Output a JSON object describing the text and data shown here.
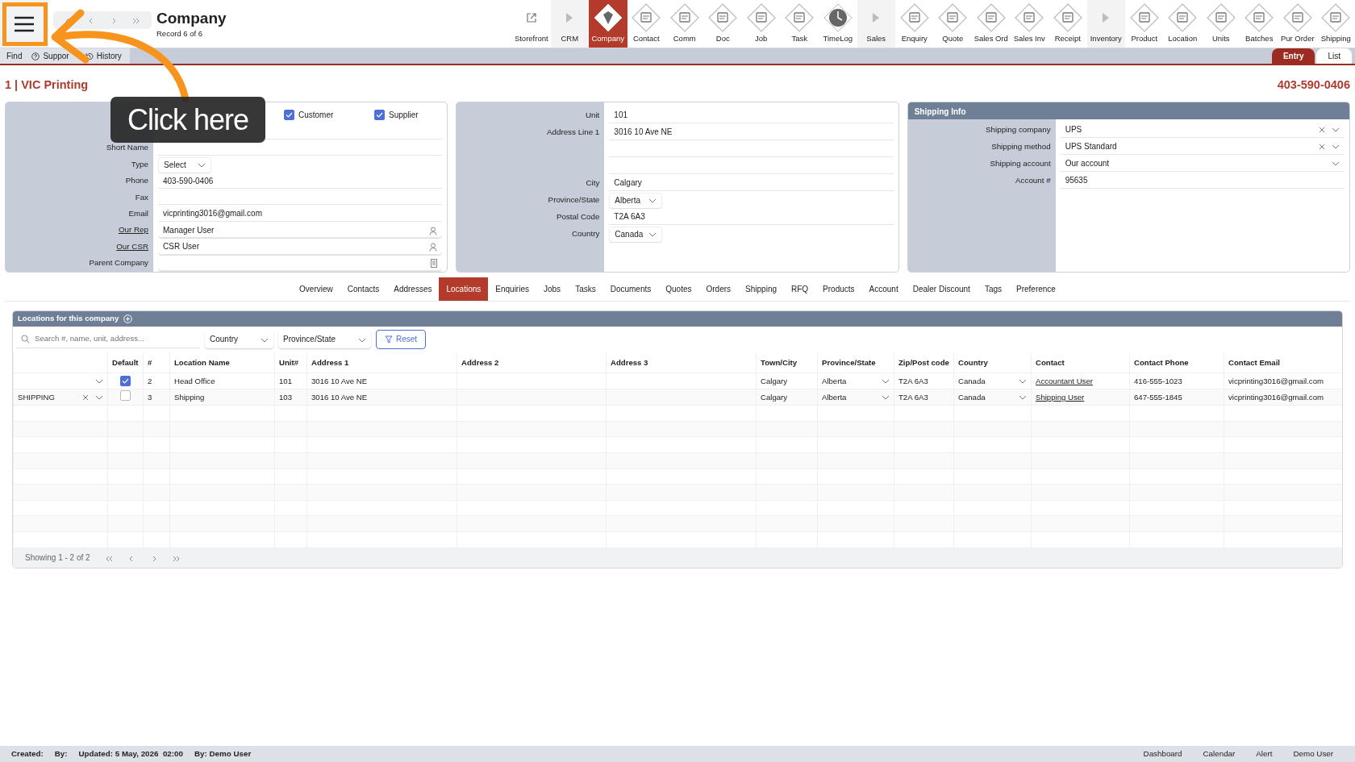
{
  "header": {
    "title": "Company",
    "subtitle": "Record 6 of 6"
  },
  "toolbar": [
    {
      "label": "Storefront",
      "kind": "link",
      "selected": false
    },
    {
      "label": "CRM",
      "kind": "section",
      "selected": false
    },
    {
      "label": "Company",
      "kind": "module",
      "selected": true
    },
    {
      "label": "Contact",
      "kind": "module",
      "selected": false
    },
    {
      "label": "Comm",
      "kind": "module",
      "selected": false
    },
    {
      "label": "Doc",
      "kind": "module",
      "selected": false
    },
    {
      "label": "Job",
      "kind": "module",
      "selected": false
    },
    {
      "label": "Task",
      "kind": "module",
      "selected": false
    },
    {
      "label": "TimeLog",
      "kind": "clock",
      "selected": false
    },
    {
      "label": "Sales",
      "kind": "section",
      "selected": false
    },
    {
      "label": "Enquiry",
      "kind": "module",
      "selected": false
    },
    {
      "label": "Quote",
      "kind": "module",
      "selected": false
    },
    {
      "label": "Sales Ord",
      "kind": "module",
      "selected": false
    },
    {
      "label": "Sales Inv",
      "kind": "module",
      "selected": false
    },
    {
      "label": "Receipt",
      "kind": "module",
      "selected": false
    },
    {
      "label": "Inventory",
      "kind": "section",
      "selected": false
    },
    {
      "label": "Product",
      "kind": "module",
      "selected": false
    },
    {
      "label": "Location",
      "kind": "module",
      "selected": false
    },
    {
      "label": "Units",
      "kind": "module",
      "selected": false
    },
    {
      "label": "Batches",
      "kind": "module",
      "selected": false
    },
    {
      "label": "Pur Order",
      "kind": "module",
      "selected": false
    },
    {
      "label": "Shipping",
      "kind": "module",
      "selected": false
    }
  ],
  "subbar": {
    "items": [
      {
        "label": "Find",
        "kind": "plain"
      },
      {
        "label": "Suppor",
        "kind": "help"
      },
      {
        "label": "History",
        "kind": "history"
      }
    ],
    "views": [
      {
        "label": "Entry",
        "selected": true
      },
      {
        "label": "List",
        "selected": false
      }
    ]
  },
  "record": {
    "title": "1 | VIC Printing",
    "phone": "403-590-0406"
  },
  "company_form": {
    "checkboxes": [
      {
        "label": "Customer",
        "checked": true
      },
      {
        "label": "Supplier",
        "checked": true
      }
    ],
    "fields": [
      {
        "kind": "checks"
      },
      {
        "kind": "text"
      },
      {
        "label": "Short Name",
        "kind": "text"
      },
      {
        "label": "Type",
        "kind": "select",
        "value": "Select"
      },
      {
        "label": "Phone",
        "kind": "text",
        "value": "403-590-0406"
      },
      {
        "label": "Fax",
        "kind": "text"
      },
      {
        "label": "Email",
        "kind": "text",
        "value": "vicprinting3016@gmail.com"
      },
      {
        "label": "Our Rep",
        "kind": "user",
        "value": "Manager User"
      },
      {
        "label": "Our CSR",
        "kind": "user",
        "value": "CSR User"
      },
      {
        "label": "Parent Company",
        "kind": "lookup"
      }
    ]
  },
  "address_form": {
    "fields": [
      {
        "label": "Unit",
        "kind": "text",
        "value": "101"
      },
      {
        "label": "Address Line 1",
        "kind": "text",
        "value": "3016 10 Ave NE"
      },
      {
        "kind": "text"
      },
      {
        "kind": "text"
      },
      {
        "label": "City",
        "kind": "text",
        "value": "Calgary"
      },
      {
        "label": "Province/State",
        "kind": "select",
        "value": "Alberta"
      },
      {
        "label": "Postal Code",
        "kind": "text",
        "value": "T2A 6A3"
      },
      {
        "label": "Country",
        "kind": "select",
        "value": "Canada"
      }
    ]
  },
  "shipping_info": {
    "title": "Shipping Info",
    "fields": [
      {
        "label": "Shipping company",
        "kind": "clearable",
        "value": "UPS"
      },
      {
        "label": "Shipping method",
        "kind": "clearable",
        "value": "UPS Standard"
      },
      {
        "label": "Shipping account",
        "kind": "dropdown",
        "value": "Our account"
      },
      {
        "label": "Account #",
        "kind": "text",
        "value": "95635"
      }
    ]
  },
  "tabs": [
    {
      "label": "Overview",
      "selected": false
    },
    {
      "label": "Contacts",
      "selected": false
    },
    {
      "label": "Addresses",
      "selected": false
    },
    {
      "label": "Locations",
      "selected": true
    },
    {
      "label": "Enquiries",
      "selected": false
    },
    {
      "label": "Jobs",
      "selected": false
    },
    {
      "label": "Tasks",
      "selected": false
    },
    {
      "label": "Documents",
      "selected": false
    },
    {
      "label": "Quotes",
      "selected": false
    },
    {
      "label": "Orders",
      "selected": false
    },
    {
      "label": "Shipping",
      "selected": false
    },
    {
      "label": "RFQ",
      "selected": false
    },
    {
      "label": "Products",
      "selected": false
    },
    {
      "label": "Account",
      "selected": false
    },
    {
      "label": "Dealer Discount",
      "selected": false
    },
    {
      "label": "Tags",
      "selected": false
    },
    {
      "label": "Preference",
      "selected": false
    }
  ],
  "locations": {
    "title": "Locations for this company",
    "search": {
      "placeholder": "Search #, name, unit, address..."
    },
    "filters": [
      {
        "placeholder": "Country"
      },
      {
        "placeholder": "Province/State"
      }
    ],
    "reset": "Reset",
    "table": {
      "columns": [
        "Default",
        "#",
        "Location Name",
        "Unit#",
        "Address 1",
        "Address 2",
        "Address 3",
        "Town/City",
        "Province/State",
        "Zip/Post code",
        "Country",
        "Contact",
        "Contact Phone",
        "Contact Email"
      ],
      "rows": [
        {
          "type": "",
          "default": true,
          "number": "2",
          "name": "Head Office",
          "unit": "101",
          "address_1": "3016 10 Ave NE",
          "city": "Calgary",
          "province": "Alberta",
          "zip": "T2A 6A3",
          "country": "Canada",
          "contact": "Accountant User",
          "phone": "416-555-1023",
          "email": "vicprinting3016@gmail.com"
        },
        {
          "type": "SHIPPING",
          "default": false,
          "number": "3",
          "name": "Shipping",
          "unit": "103",
          "address_1": "3016 10 Ave NE",
          "city": "Calgary",
          "province": "Alberta",
          "zip": "T2A 6A3",
          "country": "Canada",
          "contact": "Shipping User",
          "phone": "647-555-1845",
          "email": "vicprinting3016@gmail.com"
        }
      ]
    },
    "footer": "Showing 1 - 2 of 2"
  },
  "status_bar": {
    "left": [
      {
        "label": "Created:"
      },
      {
        "label": "By:"
      },
      {
        "label": "Updated: 5 May, 2026  02:00"
      },
      {
        "label": "By: Demo User"
      }
    ],
    "right": [
      "Dashboard",
      "Calendar",
      "Alert",
      "Demo User"
    ]
  },
  "callout": {
    "text": "Click here"
  }
}
